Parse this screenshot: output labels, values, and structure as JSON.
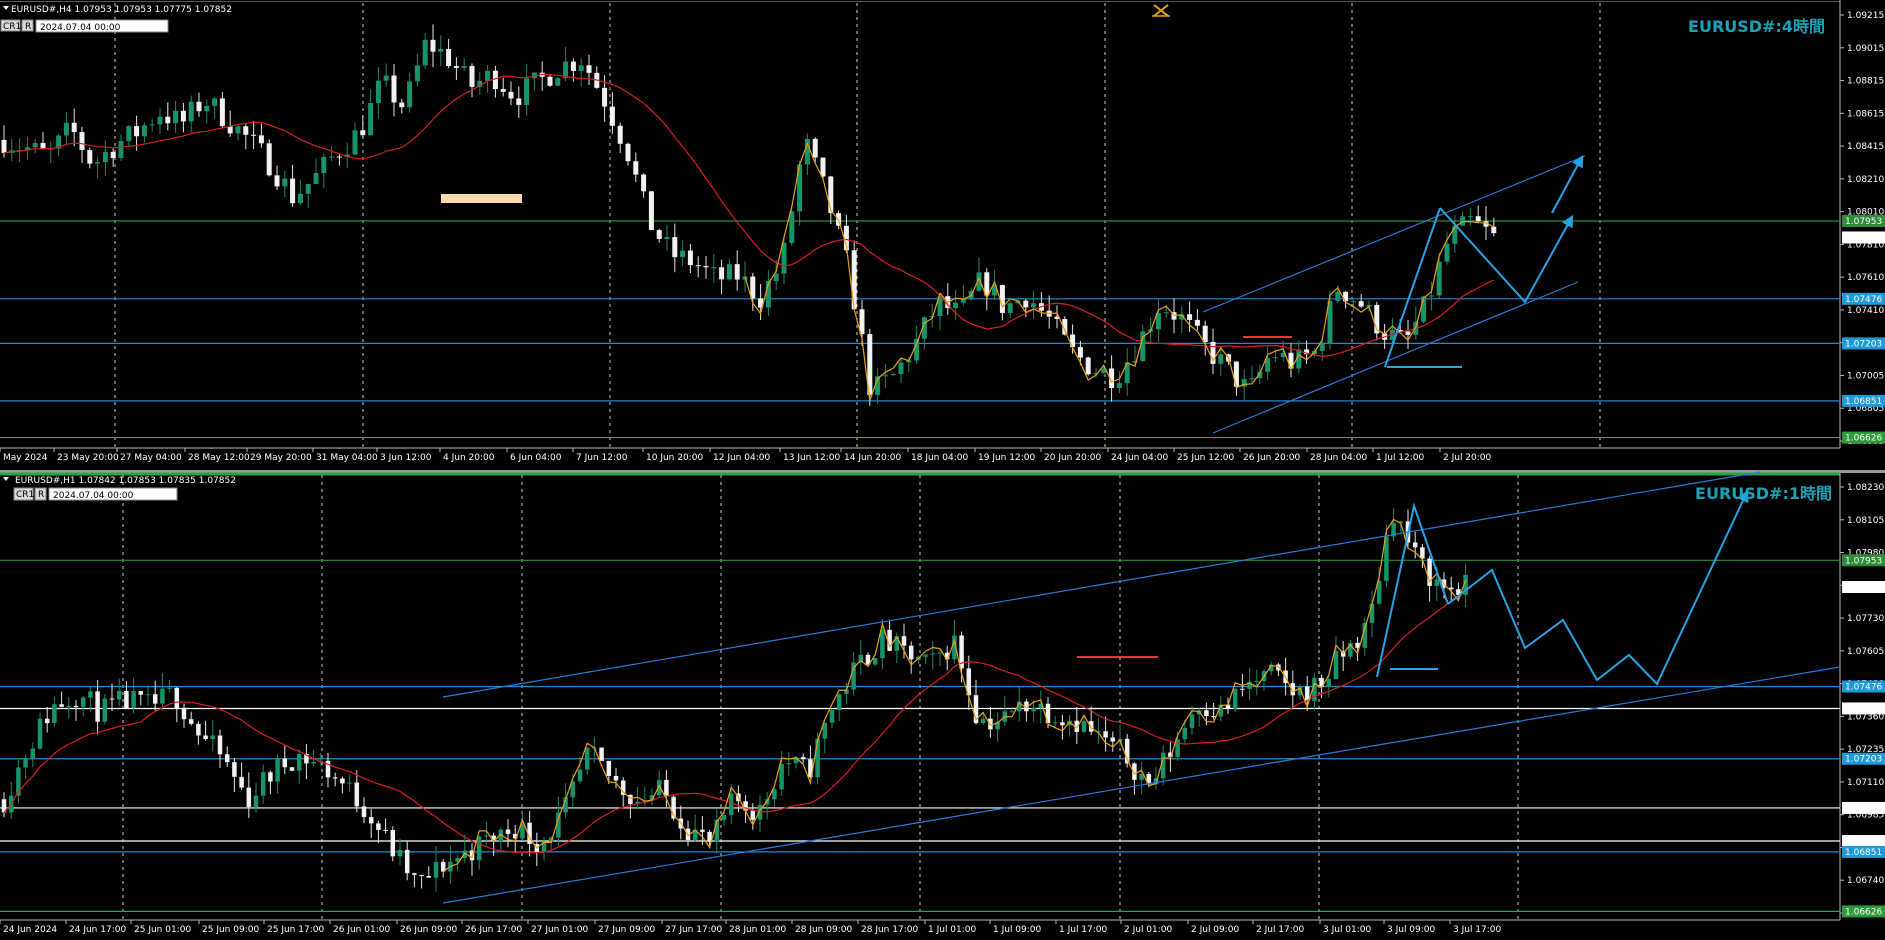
{
  "top": {
    "header": "EURUSD#,H4  1.07953 1.07953 1.07775 1.07852",
    "date_value": "2024.07.04 00:00",
    "btn_cr": "CR1",
    "btn_r": "R",
    "title": "EURUSD#:4時間",
    "price_labels": [
      "1.09215",
      "1.09015",
      "1.08815",
      "1.08615",
      "1.08415",
      "1.08210",
      "1.08010",
      "1.07810",
      "1.07610",
      "1.07410",
      "1.07205",
      "1.07005",
      "1.06805",
      "1.06605"
    ],
    "tagged_levels": [
      "1.07953",
      "1.07852",
      "1.07476",
      "1.07203",
      "1.06851",
      "1.06626"
    ],
    "time_labels": [
      "May 2024",
      "23 May 20:00",
      "27 May 04:00",
      "28 May 12:00",
      "29 May 20:00",
      "31 May 04:00",
      "3 Jun 12:00",
      "4 Jun 20:00",
      "6 Jun 04:00",
      "7 Jun 12:00",
      "10 Jun 20:00",
      "12 Jun 04:00",
      "13 Jun 12:00",
      "14 Jun 20:00",
      "18 Jun 04:00",
      "19 Jun 12:00",
      "20 Jun 20:00",
      "24 Jun 04:00",
      "25 Jun 12:00",
      "26 Jun 20:00",
      "28 Jun 04:00",
      "1 Jul 12:00",
      "2 Jul 20:00"
    ]
  },
  "bottom": {
    "header": "EURUSD#,H1  1.07842 1.07853 1.07835 1.07852",
    "date_value": "2024.07.04 00:00",
    "btn_cr": "CR1",
    "btn_r": "R",
    "title": "EURUSD#:1時間",
    "price_labels": [
      "1.08230",
      "1.08105",
      "1.07980",
      "1.07855",
      "1.07730",
      "1.07605",
      "1.07480",
      "1.07360",
      "1.07235",
      "1.07110",
      "1.06985",
      "1.06860",
      "1.06740",
      "1.06620"
    ],
    "tagged_levels": [
      "1.07953",
      "1.07852",
      "1.07476",
      "1.07393",
      "1.07203",
      "1.07017",
      "1.06892",
      "1.06851",
      "1.06626"
    ],
    "time_labels": [
      "24 Jun 2024",
      "24 Jun 17:00",
      "25 Jun 01:00",
      "25 Jun 09:00",
      "25 Jun 17:00",
      "26 Jun 01:00",
      "26 Jun 09:00",
      "26 Jun 17:00",
      "27 Jun 01:00",
      "27 Jun 09:00",
      "27 Jun 17:00",
      "28 Jun 01:00",
      "28 Jun 09:00",
      "28 Jun 17:00",
      "1 Jul 01:00",
      "1 Jul 09:00",
      "1 Jul 17:00",
      "2 Jul 01:00",
      "2 Jul 09:00",
      "2 Jul 17:00",
      "3 Jul 01:00",
      "3 Jul 09:00",
      "3 Jul 17:00"
    ]
  },
  "chart_data": [
    {
      "type": "candlestick",
      "title": "EURUSD#:4時間",
      "timeframe": "H4",
      "ylim": [
        1.06605,
        1.09215
      ],
      "close_path": [
        1.0845,
        1.084,
        1.0835,
        1.0852,
        1.083,
        1.0842,
        1.085,
        1.0862,
        1.0855,
        1.087,
        1.0858,
        1.0845,
        1.083,
        1.081,
        1.0822,
        1.0838,
        1.085,
        1.088,
        1.0865,
        1.0905,
        1.0895,
        1.0878,
        1.0885,
        1.0872,
        1.088,
        1.089,
        1.0895,
        1.087,
        1.084,
        1.0795,
        1.0775,
        1.077,
        1.076,
        1.0762,
        1.0748,
        1.077,
        1.0845,
        1.081,
        1.0765,
        1.069,
        1.07,
        1.072,
        1.0745,
        1.0738,
        1.076,
        1.0742,
        1.075,
        1.0735,
        1.0715,
        1.0705,
        1.07,
        1.072,
        1.0745,
        1.0735,
        1.0718,
        1.0705,
        1.069,
        1.0715,
        1.0708,
        1.0715,
        1.0755,
        1.0745,
        1.0728,
        1.072,
        1.0745,
        1.0785,
        1.0795,
        1.0785
      ],
      "horizontal_levels": [
        1.07953,
        1.07476,
        1.07203,
        1.06851,
        1.06626
      ],
      "current_price": 1.07852
    },
    {
      "type": "candlestick",
      "title": "EURUSD#:1時間",
      "timeframe": "H1",
      "ylim": [
        1.0662,
        1.0823
      ],
      "close_path": [
        1.0705,
        1.0725,
        1.074,
        1.0745,
        1.0738,
        1.0742,
        1.074,
        1.0745,
        1.073,
        1.072,
        1.0705,
        1.0715,
        1.0722,
        1.0718,
        1.071,
        1.07,
        1.0685,
        1.0672,
        1.068,
        1.0685,
        1.069,
        1.0695,
        1.0688,
        1.07,
        1.0722,
        1.0712,
        1.0705,
        1.0708,
        1.0695,
        1.0688,
        1.0705,
        1.07,
        1.072,
        1.0715,
        1.074,
        1.0755,
        1.0765,
        1.076,
        1.0755,
        1.0765,
        1.0735,
        1.0735,
        1.0742,
        1.0738,
        1.0735,
        1.0728,
        1.0722,
        1.071,
        1.0725,
        1.0742,
        1.0738,
        1.0748,
        1.0752,
        1.0745,
        1.0748,
        1.076,
        1.077,
        1.0815,
        1.0795,
        1.0785,
        1.0785
      ],
      "horizontal_levels": [
        1.07953,
        1.07476,
        1.07393,
        1.07203,
        1.07017,
        1.06892,
        1.06851,
        1.06626
      ],
      "current_price": 1.07852
    }
  ]
}
